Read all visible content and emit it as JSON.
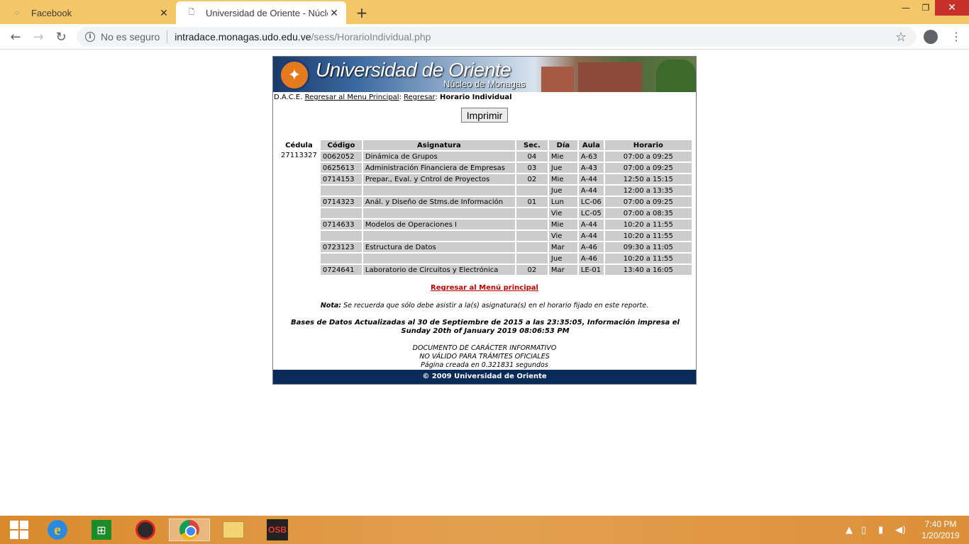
{
  "browser": {
    "tabs": [
      {
        "title": "Facebook",
        "active": false
      },
      {
        "title": "Universidad de Oriente - Núcleo",
        "active": true
      }
    ],
    "omnibox": {
      "security_label": "No es seguro",
      "host": "intradace.monagas.udo.edu.ve",
      "path": "/sess/HorarioIndividual.php"
    }
  },
  "banner": {
    "university": "Universidad de Oriente",
    "nucleus": "Núcleo de Monagas"
  },
  "breadcrumb": {
    "root": "D.A.C.E.",
    "link_menu": "Regresar al Menu Principal",
    "link_back": "Regresar",
    "current": "Horario Individual"
  },
  "print_button": "Imprimir",
  "schedule": {
    "headers": [
      "Cédula",
      "Código",
      "Asignatura",
      "Sec.",
      "Día",
      "Aula",
      "Horario"
    ],
    "cedula": "27113327",
    "rows": [
      {
        "codigo": "0062052",
        "asignatura": "Dinámica de Grupos",
        "sec": "04",
        "dia": "Mie",
        "aula": "A-63",
        "horario": "07:00 a 09:25"
      },
      {
        "codigo": "0625613",
        "asignatura": "Administración Financiera de Empresas",
        "sec": "03",
        "dia": "Jue",
        "aula": "A-43",
        "horario": "07:00 a 09:25"
      },
      {
        "codigo": "0714153",
        "asignatura": "Prepar., Eval. y Cntrol de Proyectos",
        "sec": "02",
        "dia": "Mie",
        "aula": "A-44",
        "horario": "12:50 a 15:15"
      },
      {
        "codigo": "",
        "asignatura": "",
        "sec": "",
        "dia": "Jue",
        "aula": "A-44",
        "horario": "12:00 a 13:35"
      },
      {
        "codigo": "0714323",
        "asignatura": "Anál. y Diseño de Stms.de Información",
        "sec": "01",
        "dia": "Lun",
        "aula": "LC-06",
        "horario": "07:00 a 09:25"
      },
      {
        "codigo": "",
        "asignatura": "",
        "sec": "",
        "dia": "Vie",
        "aula": "LC-05",
        "horario": "07:00 a 08:35"
      },
      {
        "codigo": "0714633",
        "asignatura": "Modelos de Operaciones I",
        "sec": "",
        "dia": "Mie",
        "aula": "A-44",
        "horario": "10:20 a 11:55"
      },
      {
        "codigo": "",
        "asignatura": "",
        "sec": "",
        "dia": "Vie",
        "aula": "A-44",
        "horario": "10:20 a 11:55"
      },
      {
        "codigo": "0723123",
        "asignatura": "Estructura de Datos",
        "sec": "",
        "dia": "Mar",
        "aula": "A-46",
        "horario": "09:30 a 11:05"
      },
      {
        "codigo": "",
        "asignatura": "",
        "sec": "",
        "dia": "Jue",
        "aula": "A-46",
        "horario": "10:20 a 11:55"
      },
      {
        "codigo": "0724641",
        "asignatura": "Laboratorio de Circuitos y Electrónica",
        "sec": "02",
        "dia": "Mar",
        "aula": "LE-01",
        "horario": "13:40 a 16:05"
      }
    ]
  },
  "back_link": "Regresar al Menú principal",
  "nota": {
    "label": "Nota:",
    "text": " Se recuerda que sólo debe asistir a la(s) asignatura(s) en el horario fijado en este reporte."
  },
  "bases": {
    "line1": "Bases de Datos Actualizadas al 30 de Septiembre de 2015 a las 23:35:05, Información impresa el",
    "line2": "Sunday 20th of January 2019 08:06:53 PM"
  },
  "document": {
    "line1": "DOCUMENTO DE CARÁCTER INFORMATIVO",
    "line2": "NO VÁLIDO PARA TRÁMITES OFICIALES",
    "line3": "Página creada en 0.321831 segundos"
  },
  "footer": "© 2009 Universidad de Oriente",
  "taskbar": {
    "clock_time": "7:40 PM",
    "clock_date": "1/20/2019",
    "osb_label": "OSB"
  },
  "colors": {
    "title_bar": "#f3c768",
    "footer_bg": "#0a2b5a",
    "table_cell": "#cccccc",
    "back_link": "#c00000"
  }
}
